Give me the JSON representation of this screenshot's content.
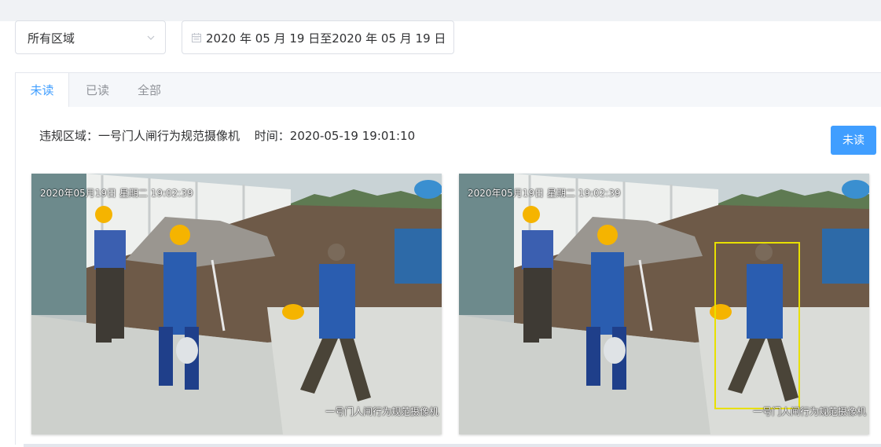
{
  "filters": {
    "area_select": {
      "value": "所有区域",
      "icon": "chevron-down-icon"
    },
    "date_range": {
      "value": "2020 年 05 月 19 日至2020 年 05 月 19 日",
      "icon": "calendar-icon"
    }
  },
  "tabs": [
    {
      "label": "未读",
      "active": true
    },
    {
      "label": "已读",
      "active": false
    },
    {
      "label": "全部",
      "active": false
    }
  ],
  "record": {
    "area_text": "违规区域：一号门人闸行为规范摄像机",
    "time_text": "时间：2020-05-19 19:01:10",
    "status_button": "未读"
  },
  "snapshots": [
    {
      "osd_timestamp": "2020年05月19日  星期二  19:02:39",
      "osd_camera": "一号门人闸行为规范摄像机",
      "detection_box": false
    },
    {
      "osd_timestamp": "2020年05月19日  星期二  19:02:39",
      "osd_camera": "一号门人闸行为规范摄像机",
      "detection_box": true
    }
  ],
  "colors": {
    "accent": "#409eff",
    "detection_box": "#e8e000",
    "helmet": "#f5b400",
    "uniform": "#2a5db0"
  }
}
